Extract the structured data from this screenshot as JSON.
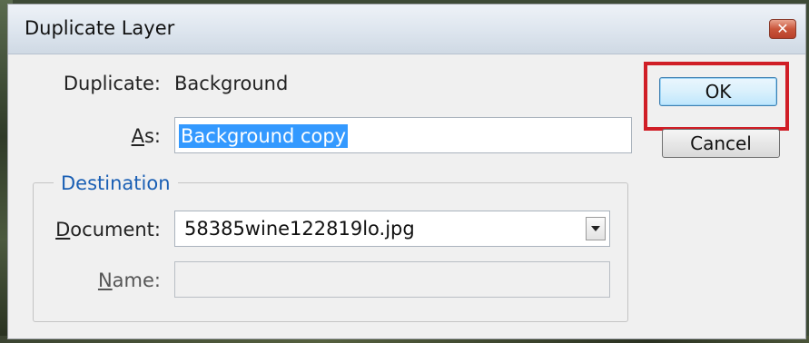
{
  "dialog": {
    "title": "Duplicate Layer",
    "close_glyph": "✕"
  },
  "duplicate": {
    "label": "Duplicate:",
    "value": "Background"
  },
  "as": {
    "label_accel": "A",
    "label_rest": "s:",
    "value": "Background copy"
  },
  "destination": {
    "legend": "Destination",
    "document": {
      "label_accel": "D",
      "label_rest": "ocument:",
      "value": "58385wine122819lo.jpg"
    },
    "name": {
      "label_accel": "N",
      "label_rest": "ame:",
      "value": ""
    }
  },
  "buttons": {
    "ok": "OK",
    "cancel": "Cancel"
  },
  "colors": {
    "highlight": "#d01e26",
    "legend": "#1a5fb4",
    "selection": "#3399ff"
  },
  "icons": {
    "close": "close-icon",
    "dropdown": "chevron-down-icon"
  }
}
